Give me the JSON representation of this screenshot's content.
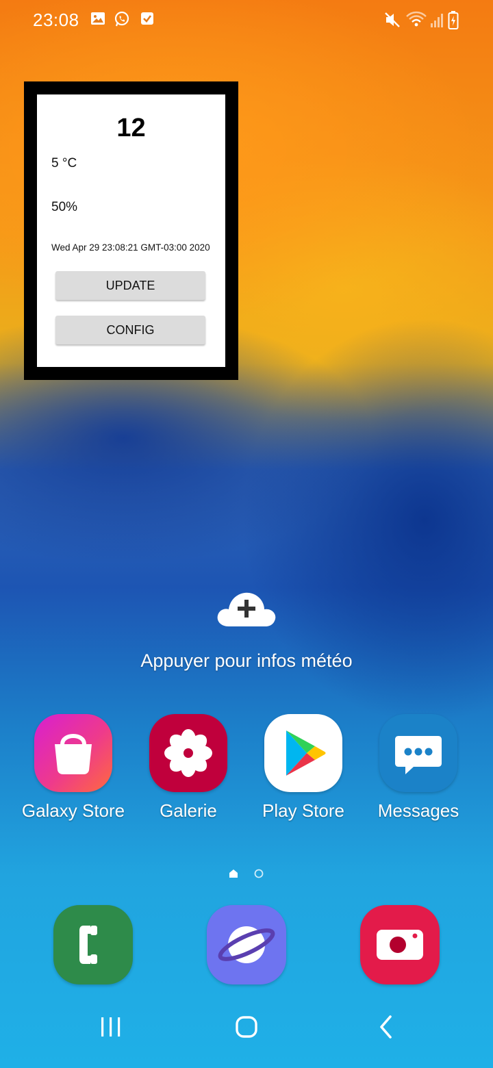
{
  "status_bar": {
    "time": "23:08",
    "left_icons": [
      "image-icon",
      "whatsapp-icon",
      "checkbox-icon"
    ],
    "right_icons": [
      "mute-icon",
      "wifi-icon",
      "signal-icon",
      "battery-charging-icon"
    ]
  },
  "widget": {
    "title": "12",
    "temperature": "5 °C",
    "humidity": "50%",
    "date": "Wed Apr 29 23:08:21 GMT-03:00 2020",
    "update_label": "UPDATE",
    "config_label": "CONFIG"
  },
  "weather": {
    "icon": "cloud-plus-icon",
    "text": "Appuyer pour infos météo"
  },
  "apps": [
    {
      "label": "Galaxy Store",
      "icon": "galaxy-store-icon",
      "color": "#e0338a"
    },
    {
      "label": "Galerie",
      "icon": "gallery-icon",
      "color": "#c0003c"
    },
    {
      "label": "Play Store",
      "icon": "play-store-icon",
      "color": "#ffffff"
    },
    {
      "label": "Messages",
      "icon": "messages-icon",
      "color": "#1b82c8"
    }
  ],
  "page_indicator": {
    "pages": 2,
    "current": 1
  },
  "dock": [
    {
      "icon": "phone-icon",
      "color": "#2e8b4a"
    },
    {
      "icon": "internet-icon",
      "color": "#6e74f0"
    },
    {
      "icon": "camera-icon",
      "color": "#e31b4a"
    }
  ],
  "nav_bar": [
    "recents-icon",
    "home-icon",
    "back-icon"
  ]
}
